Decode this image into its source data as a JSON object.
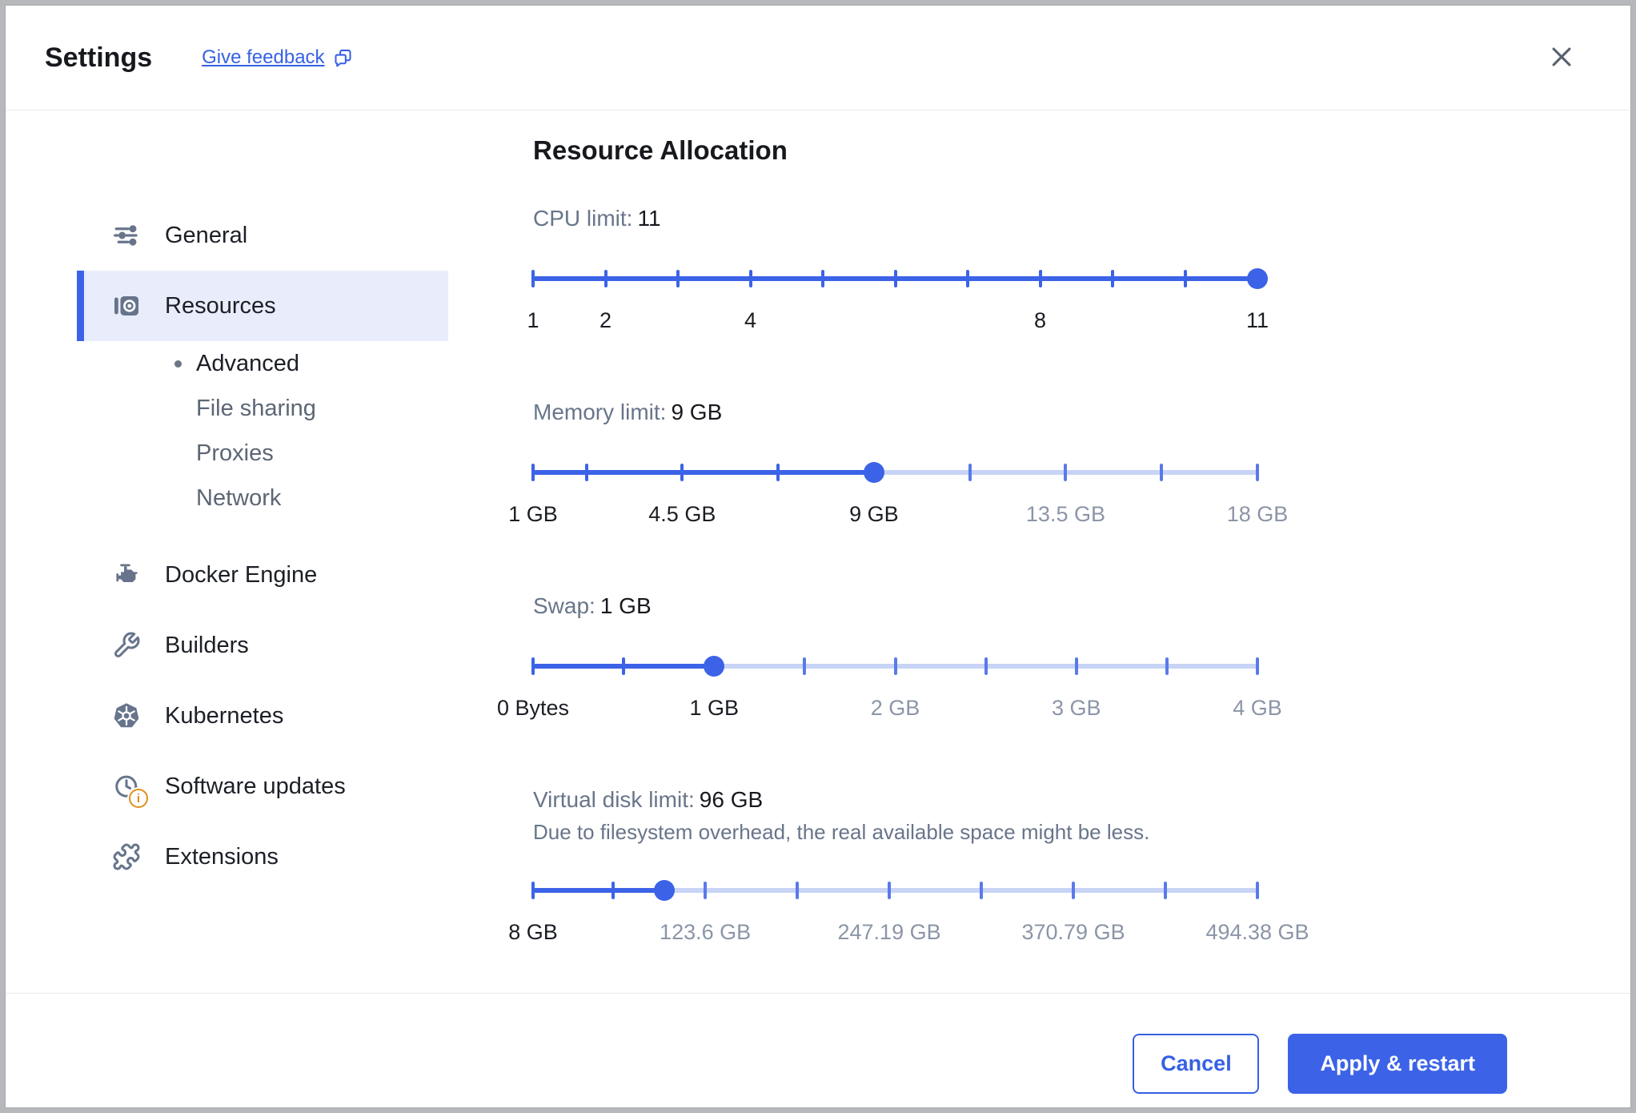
{
  "header": {
    "title": "Settings",
    "feedback_label": "Give feedback",
    "feedback_icon": "chat-bubbles-icon",
    "close_icon": "close-x-icon"
  },
  "sidebar": {
    "items": [
      {
        "type": "item",
        "label": "General",
        "icon": "tune-icon",
        "selected": false
      },
      {
        "type": "item",
        "label": "Resources",
        "icon": "resources-icon",
        "selected": true
      },
      {
        "type": "sub",
        "label": "Advanced",
        "active": true
      },
      {
        "type": "sub",
        "label": "File sharing",
        "active": false
      },
      {
        "type": "sub",
        "label": "Proxies",
        "active": false
      },
      {
        "type": "sub",
        "label": "Network",
        "active": false
      },
      {
        "type": "item",
        "label": "Docker Engine",
        "icon": "engine-icon",
        "selected": false,
        "gap": true
      },
      {
        "type": "item",
        "label": "Builders",
        "icon": "wrench-icon",
        "selected": false
      },
      {
        "type": "item",
        "label": "Kubernetes",
        "icon": "kubernetes-icon",
        "selected": false
      },
      {
        "type": "item",
        "label": "Software updates",
        "icon": "clock-update-icon",
        "badge": "info-badge-icon",
        "selected": false
      },
      {
        "type": "item",
        "label": "Extensions",
        "icon": "puzzle-icon",
        "selected": false
      }
    ]
  },
  "main": {
    "heading": "Resource Allocation",
    "sliders": [
      {
        "id": "cpu-limit",
        "label": "CPU limit:",
        "value_text": "11",
        "min": 1,
        "max": 11,
        "value": 11,
        "ticks": [
          1,
          2,
          3,
          4,
          5,
          6,
          7,
          8,
          9,
          10,
          11
        ],
        "labels": [
          {
            "text": "1",
            "value": 1
          },
          {
            "text": "2",
            "value": 2
          },
          {
            "text": "4",
            "value": 4
          },
          {
            "text": "8",
            "value": 8
          },
          {
            "text": "11",
            "value": 11
          }
        ]
      },
      {
        "id": "memory-limit",
        "label": "Memory limit:",
        "value_text": "9 GB",
        "min": 1,
        "max": 18,
        "value": 9,
        "ticks": [
          1,
          2.25,
          4.5,
          6.75,
          9,
          11.25,
          13.5,
          15.75,
          18
        ],
        "labels": [
          {
            "text": "1 GB",
            "value": 1
          },
          {
            "text": "4.5 GB",
            "value": 4.5
          },
          {
            "text": "9 GB",
            "value": 9
          },
          {
            "text": "13.5 GB",
            "value": 13.5
          },
          {
            "text": "18 GB",
            "value": 18
          }
        ]
      },
      {
        "id": "swap",
        "label": "Swap:",
        "value_text": "1 GB",
        "min": 0,
        "max": 4,
        "value": 1,
        "ticks": [
          0,
          0.5,
          1,
          1.5,
          2,
          2.5,
          3,
          3.5,
          4
        ],
        "labels": [
          {
            "text": "0 Bytes",
            "value": 0
          },
          {
            "text": "1 GB",
            "value": 1
          },
          {
            "text": "2 GB",
            "value": 2
          },
          {
            "text": "3 GB",
            "value": 3
          },
          {
            "text": "4 GB",
            "value": 4
          }
        ]
      },
      {
        "id": "virtual-disk-limit",
        "label": "Virtual disk limit:",
        "value_text": "96 GB",
        "note": "Due to filesystem overhead, the real available space might be less.",
        "min": 8,
        "max": 494.38,
        "value": 96,
        "ticks": [
          8,
          61.8,
          123.6,
          185.4,
          247.19,
          308.99,
          370.79,
          432.58,
          494.38
        ],
        "labels": [
          {
            "text": "8 GB",
            "value": 8
          },
          {
            "text": "123.6 GB",
            "value": 123.6
          },
          {
            "text": "247.19 GB",
            "value": 247.19
          },
          {
            "text": "370.79 GB",
            "value": 370.79
          },
          {
            "text": "494.38 GB",
            "value": 494.38
          }
        ]
      }
    ]
  },
  "footer": {
    "cancel_label": "Cancel",
    "apply_label": "Apply & restart"
  },
  "colors": {
    "accent_blue": "#3c63e7",
    "track_light_blue": "#c7d4f6",
    "selected_item_bg": "#e9edfb",
    "badge_orange": "#dd8f1f",
    "icon_gray": "#67748b"
  }
}
